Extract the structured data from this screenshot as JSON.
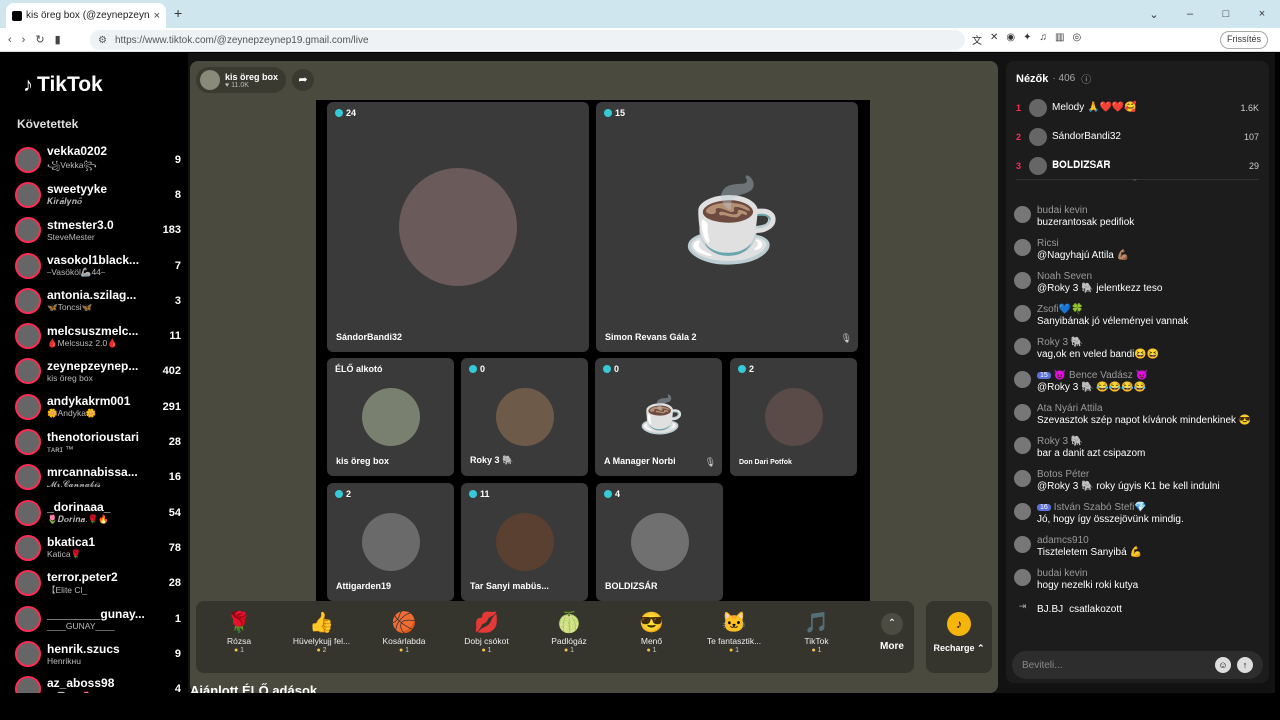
{
  "browser": {
    "tab_title": "kis öreg box (@zeynepzeyne|",
    "tab_close": "×",
    "new_tab": "+",
    "url": "https://www.tiktok.com/@zeynepzeynep19.gmail.com/live",
    "reload_label": "Frissítés",
    "win_min": "⌄",
    "win_restore": "–",
    "win_max": "□",
    "win_close": "×"
  },
  "brand": {
    "name": "TikTok",
    "logo_icon": "♪"
  },
  "following": {
    "heading": "Követettek",
    "items": [
      {
        "name": "vekka0202",
        "sub": "꧁Vekka꧂",
        "count": "9"
      },
      {
        "name": "sweetyyke",
        "sub": "𝑲𝒊𝒓𝒂́𝒍𝒚𝒏𝒐̋",
        "count": "8"
      },
      {
        "name": "stmester3.0",
        "sub": "SteveMester",
        "count": "183"
      },
      {
        "name": "vasokol1black...",
        "sub": "⎯Vasököl🦾44⎯",
        "count": "7"
      },
      {
        "name": "antonia.szilag...",
        "sub": "🦋Toncsi🦋",
        "count": "3"
      },
      {
        "name": "melcsuszmelc...",
        "sub": "🩸Melcsusz 2.0🩸",
        "count": "11"
      },
      {
        "name": "zeynepzeynep...",
        "sub": "kis öreg box",
        "count": "402"
      },
      {
        "name": "andykakrm001",
        "sub": "🌼Andyka🌼",
        "count": "291"
      },
      {
        "name": "thenotorioustari",
        "sub": "ᴛᴀʀɪ ™",
        "count": "28"
      },
      {
        "name": "mrcannabissa...",
        "sub": "𝓜𝓻.𝓒𝓪𝓷𝓷𝓪𝓫𝓲𝓼",
        "count": "16"
      },
      {
        "name": "_dorinaaa_",
        "sub": "🌷𝑫𝒐𝒓𝒊𝒏𝒂.🌹🔥",
        "count": "54"
      },
      {
        "name": "bkatica1",
        "sub": "Katica🌹",
        "count": "78"
      },
      {
        "name": "terror.peter2",
        "sub": "【Elite Cl_",
        "count": "28"
      },
      {
        "name": "________gunay...",
        "sub": "____GUNAY____",
        "count": "1"
      },
      {
        "name": "henrik.szucs",
        "sub": "Henrikнu",
        "count": "9"
      },
      {
        "name": "az_aboss98",
        "sub": "Az🅰pikó🌷",
        "count": "4"
      }
    ]
  },
  "host": {
    "name": "kis öreg box",
    "likes": "♥ 11.0K",
    "share_icon": "➦"
  },
  "tiles": [
    {
      "count": "24",
      "name": "SándorBandi32",
      "mute": ""
    },
    {
      "count": "15",
      "name": "Simon Revans Gála 2",
      "mute": "🎙"
    },
    {
      "count": "ÉLŐ alkotó",
      "name": "kis öreg box",
      "mute": ""
    },
    {
      "count": "0",
      "name": "Roky 3 🐘",
      "mute": ""
    },
    {
      "count": "0",
      "name": "A Manager Norbi",
      "mute": "🎙"
    },
    {
      "count": "2",
      "name": "Don Dari Potfok",
      "mute": ""
    },
    {
      "count": "2",
      "name": "Attigarden19",
      "mute": ""
    },
    {
      "count": "11",
      "name": "Tar Sanyi mabüs...",
      "mute": ""
    },
    {
      "count": "4",
      "name": "BOLDIZSÁR",
      "mute": ""
    }
  ],
  "gifts": [
    {
      "icon": "🌹",
      "name": "Rózsa",
      "price": "1"
    },
    {
      "icon": "👍",
      "name": "Hüvelykujj fel...",
      "price": "2"
    },
    {
      "icon": "🏀",
      "name": "Kosárlabda",
      "price": "1"
    },
    {
      "icon": "💋",
      "name": "Dobj csókot",
      "price": "1"
    },
    {
      "icon": "🍈",
      "name": "Padlógáz",
      "price": "1"
    },
    {
      "icon": "😎",
      "name": "Menő",
      "price": "1"
    },
    {
      "icon": "🐱",
      "name": "Te fantasztik...",
      "price": "1"
    },
    {
      "icon": "🎵",
      "name": "TikTok",
      "price": "1"
    }
  ],
  "more": {
    "icon": "⌃",
    "label": "More"
  },
  "recharge": {
    "icon": "♪",
    "label": "Recharge ⌃"
  },
  "recommended": "Ajánlott ÉLŐ adások",
  "viewers": {
    "title": "Nézők",
    "count": "· 406",
    "info_icon": "ⓘ",
    "top": [
      {
        "rank": "1",
        "name": "Melody 🙏❤️❤️🥰",
        "value": "1.6K"
      },
      {
        "rank": "2",
        "name": "SándorBandi32",
        "value": "107"
      },
      {
        "rank": "3",
        "name": "𝐁𝐎𝐋𝐃𝐈𝐙𝐒𝐀́𝐑",
        "value": "29"
      }
    ]
  },
  "chat": [
    {
      "user": "budai kevin",
      "badge": "",
      "text": "buzerantosak pedifiok"
    },
    {
      "user": "Ricsi",
      "badge": "",
      "text": "@Nagyhajú Attila 💪🏽"
    },
    {
      "user": "Noah Seven",
      "badge": "",
      "text": "@Roky 3 🐘 jelentkezz teso"
    },
    {
      "user": "Zsofi💙🍀",
      "badge": "",
      "text": "Sanyibának jó véleményei vannak"
    },
    {
      "user": "Roky 3 🐘",
      "badge": "",
      "text": "vag,ok en veled bandi😆😆"
    },
    {
      "user": "😈 Bence Vadász 😈",
      "badge": "15",
      "text": "@Roky 3 🐘 😂😂😂😂"
    },
    {
      "user": "Ata Nyári Attila",
      "badge": "",
      "text": "Szevasztok szép napot kívánok mindenkinek 😎"
    },
    {
      "user": "Roky 3 🐘",
      "badge": "",
      "text": "bar a danit azt csipazom"
    },
    {
      "user": "Botos Péter",
      "badge": "",
      "text": "@Roky 3 🐘 roky úgyis K1 be kell indulni"
    },
    {
      "user": "István Szabó Stefi💎",
      "badge": "16",
      "text": "Jó, hogy így összejövünk mindig."
    },
    {
      "user": "adamcs910",
      "badge": "",
      "text": "Tiszteletem Sanyibá 💪"
    },
    {
      "user": "budai kevin",
      "badge": "",
      "text": "hogy nezelki roki kutya"
    }
  ],
  "joined": {
    "icon": "⇥",
    "name": "BJ.BJ",
    "text": "csatlakozott"
  },
  "chat_input": {
    "placeholder": "Beviteli...",
    "emoji_icon": "☺",
    "send_icon": "↑"
  }
}
